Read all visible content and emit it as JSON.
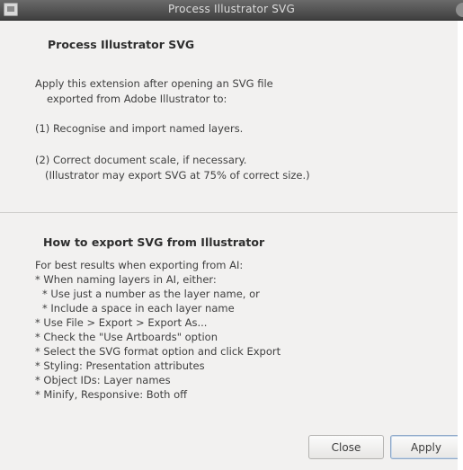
{
  "window": {
    "title": "Process Illustrator SVG"
  },
  "about": {
    "heading": "Process Illustrator SVG",
    "intro_line1": "Apply this extension after opening an SVG file",
    "intro_line2": "exported from Adobe Illustrator to:",
    "item1": "(1) Recognise and import named layers.",
    "item2_line1": "(2) Correct document scale, if necessary.",
    "item2_line2": "(Illustrator may export SVG at 75% of correct size.)"
  },
  "howto": {
    "heading": "How to export SVG from Illustrator",
    "lines": [
      "For best results when exporting from AI:",
      "* When naming layers in AI, either:",
      "* Use just a number as the layer name, or",
      "* Include a space in each layer name",
      "* Use File > Export > Export As...",
      "* Check the \"Use Artboards\" option",
      "* Select the SVG format option and click Export",
      "* Styling: Presentation attributes",
      "* Object IDs: Layer names",
      "* Minify, Responsive: Both off"
    ]
  },
  "buttons": {
    "close_label": "Close",
    "apply_label": "Apply"
  }
}
